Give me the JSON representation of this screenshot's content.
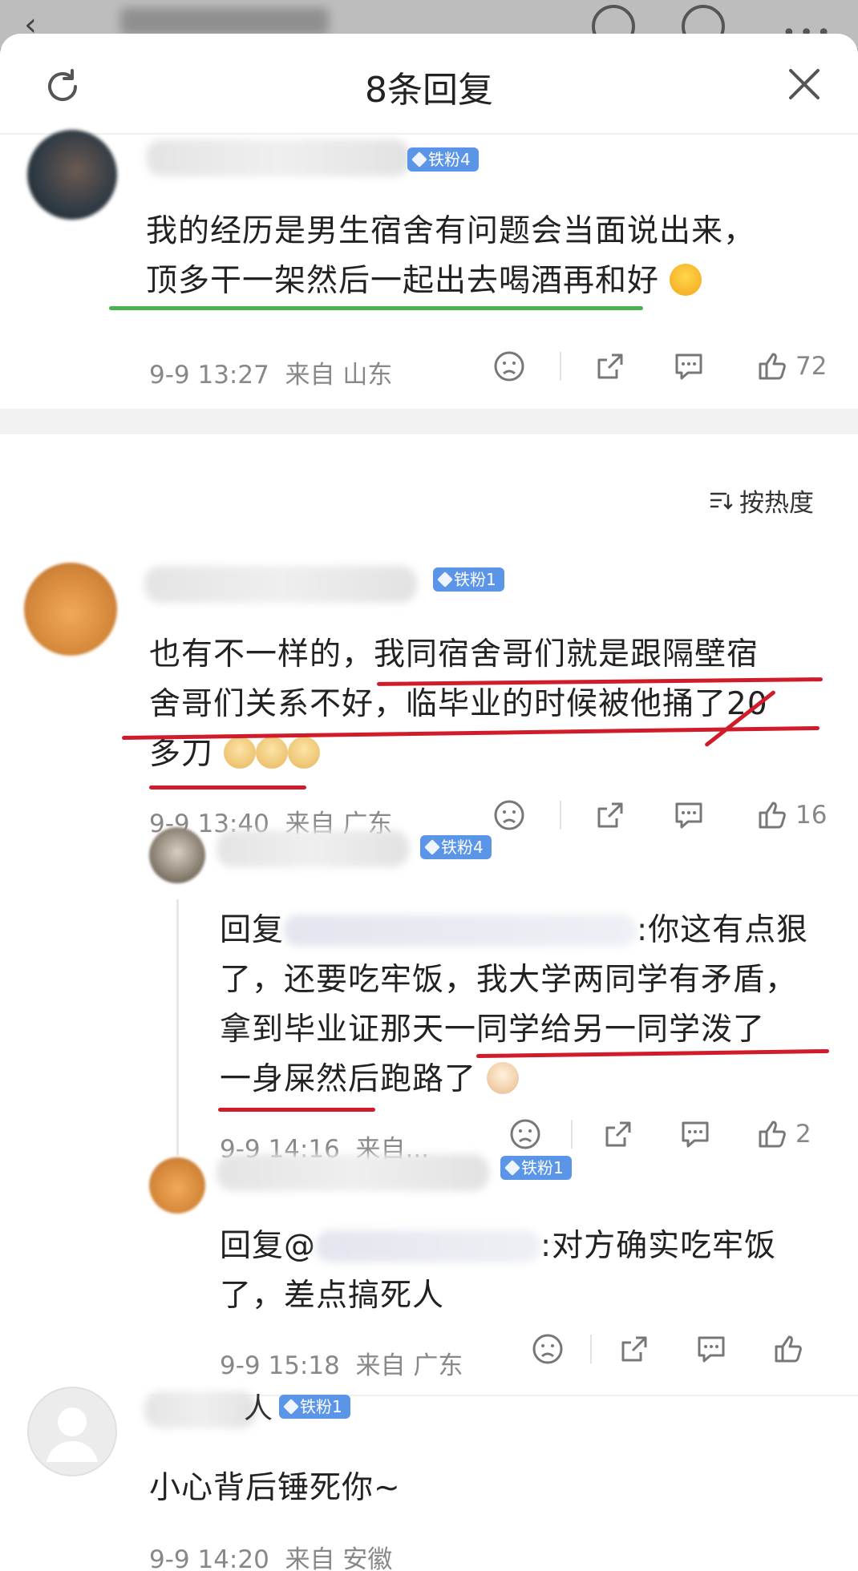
{
  "header": {
    "title": "8条回复"
  },
  "root_comment": {
    "badge": "铁粉4",
    "line1": "我的经历是男生宿舍有问题会当面说出来，",
    "line2": "顶多干一架然后一起出去喝酒再和好",
    "time": "9-9 13:27",
    "from": "来自 山东",
    "likes": "72"
  },
  "sort_label": "按热度",
  "replies": [
    {
      "badge": "铁粉1",
      "line1a": "也有不一样的，",
      "line1b": "我同宿舍哥们就是跟隔壁宿",
      "line2": "舍哥们关系不好，临毕业的时候被他捅了20",
      "line3": "多刀",
      "time": "9-9 13:40",
      "from": "来自 广东",
      "likes": "16",
      "subreplies": [
        {
          "badge": "铁粉4",
          "prefix": "回复",
          "line1end": ":你这有点狠",
          "line2": "了，还要吃牢饭，我大学两同学有矛盾，",
          "line3a": "拿到毕业证那天",
          "line3b": "一同学给另一同学泼了",
          "line4": "一身屎然后跑路了",
          "time": "9-9 14:16",
          "from": "来自...",
          "likes": "2"
        },
        {
          "badge": "铁粉1",
          "prefix": "回复@",
          "line1end": ":对方确实吃牢饭",
          "line2": "了，差点搞死人",
          "time": "9-9 15:18",
          "from": "来自 广东"
        }
      ]
    },
    {
      "name_tail": "人",
      "badge": "铁粉1",
      "line1": "小心背后锤死你~",
      "time": "9-9 14:20",
      "from": "来自 安徽"
    }
  ]
}
